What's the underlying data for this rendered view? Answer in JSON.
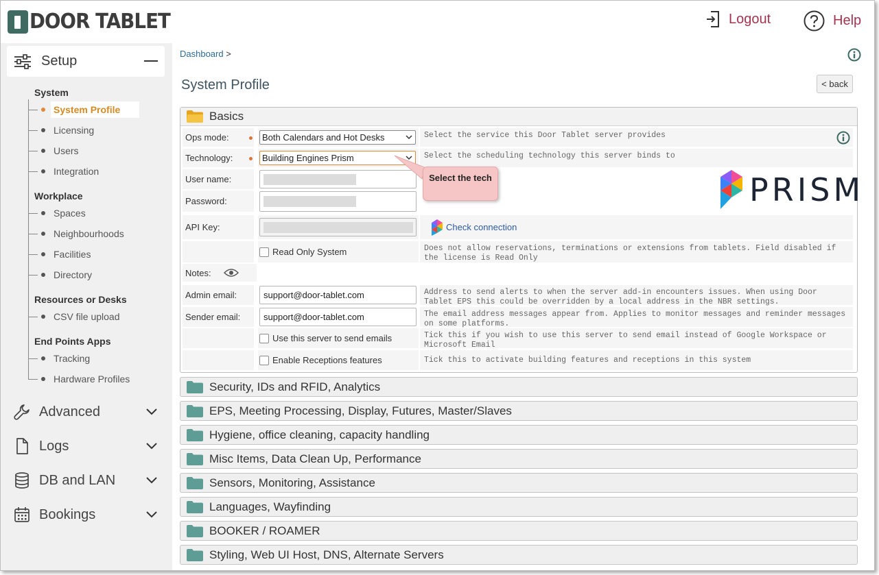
{
  "header": {
    "logo_text": "DOOR TABLET",
    "logout_label": "Logout",
    "help_label": "Help"
  },
  "sidebar": {
    "setup_label": "Setup",
    "sections": [
      {
        "title": "System",
        "items": [
          "System Profile",
          "Licensing",
          "Users",
          "Integration"
        ]
      },
      {
        "title": "Workplace",
        "items": [
          "Spaces",
          "Neighbourhoods",
          "Facilities",
          "Directory"
        ]
      },
      {
        "title": "Resources or Desks",
        "items": [
          "CSV file upload"
        ]
      },
      {
        "title": "End Points Apps",
        "items": [
          "Tracking",
          "Hardware Profiles"
        ]
      }
    ],
    "active_item": "System Profile",
    "main_nav": [
      "Advanced",
      "Logs",
      "DB and LAN",
      "Bookings"
    ]
  },
  "content": {
    "breadcrumb": "Dashboard",
    "breadcrumb_sep": ">",
    "page_title": "System Profile",
    "back_label": "< back",
    "basics_title": "Basics",
    "ops_mode": {
      "label": "Ops mode:",
      "value": "Both Calendars and Hot Desks",
      "help": "Select the service this Door Tablet server provides"
    },
    "technology": {
      "label": "Technology:",
      "value": "Building Engines Prism",
      "help": "Select the scheduling technology this server binds to"
    },
    "username_label": "User name:",
    "password_label": "Password:",
    "apikey_label": "API Key:",
    "check_connection": "Check connection",
    "read_only": {
      "label": "Read Only System",
      "help": "Does not allow reservations, terminations or extensions from tablets. Field disabled if the license is Read Only"
    },
    "notes_label": "Notes:",
    "admin_email": {
      "label": "Admin email:",
      "value": "support@door-tablet.com",
      "help": "Address to send alerts to when the server add-in encounters issues.  When using Door Tablet EPS this could be overridden by a local address in the NBR settings."
    },
    "sender_email": {
      "label": "Sender email:",
      "value": "support@door-tablet.com",
      "help": "The email address messages appear from. Applies to monitor messages and reminder messages on some platforms."
    },
    "send_emails": {
      "label": "Use this server to send emails",
      "help": "Tick this if you wish to use this server to send email instead of Google Workspace or Microsoft Email"
    },
    "receptions": {
      "label": "Enable Receptions features",
      "help": "Tick this to activate building features and receptions in this system"
    },
    "callout": "Select the tech",
    "prism_logo": "PRISM",
    "accordions": [
      "Security, IDs and RFID, Analytics",
      "EPS, Meeting Processing, Display, Futures, Master/Slaves",
      "Hygiene, office cleaning, capacity handling",
      "Misc Items, Data Clean Up, Performance",
      "Sensors, Monitoring, Assistance",
      "Languages, Wayfinding",
      "BOOKER / ROAMER",
      "Styling, Web UI Host, DNS, Alternate Servers"
    ]
  },
  "colors": {
    "accent_active": "#d58a24",
    "header_link": "#a3344f",
    "breadcrumb_link": "#2d6a9a",
    "folder_open": "#f0b92e",
    "folder_closed": "#5e9d95"
  }
}
